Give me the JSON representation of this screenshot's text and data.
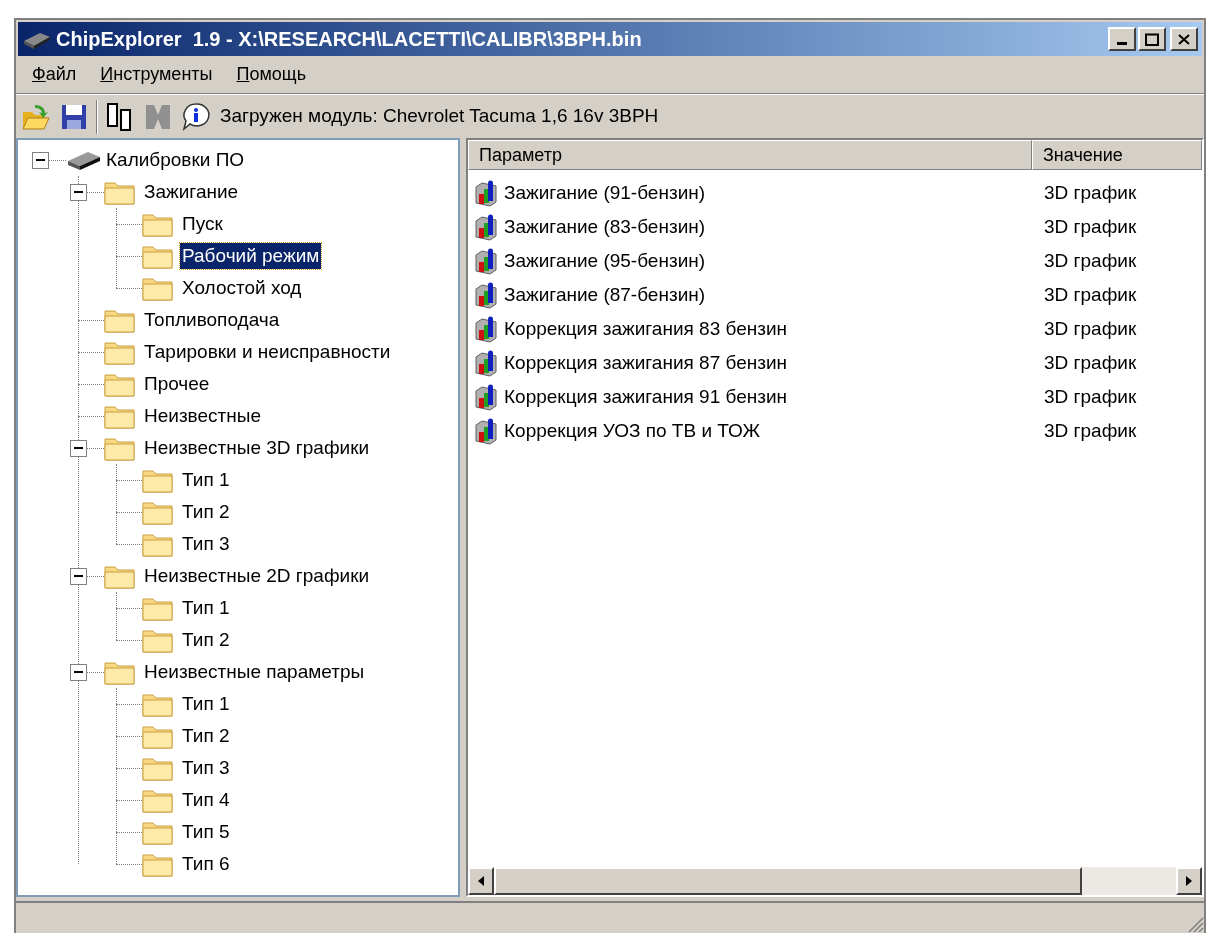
{
  "window": {
    "title": "ChipExplorer  1.9 - X:\\RESEARCH\\LACETTI\\CALIBR\\3BPH.bin"
  },
  "menu": [
    "Файл",
    "Инструменты",
    "Помощь"
  ],
  "toolbar": {
    "buttons": [
      {
        "kind": "open",
        "disabled": false
      },
      {
        "kind": "save",
        "disabled": false
      },
      {
        "kind": "device",
        "disabled": false
      },
      {
        "kind": "chip",
        "disabled": true
      },
      {
        "kind": "info",
        "disabled": false
      }
    ],
    "status_text": "Загружен модуль: Chevrolet Tacuma 1,6 16v 3BPH"
  },
  "tree": [
    {
      "label": "Калибровки ПО",
      "kind": "chip",
      "selected": false,
      "expanded": true,
      "children": [
        {
          "label": "Зажигание",
          "kind": "folder",
          "selected": false,
          "expanded": true,
          "children": [
            {
              "label": "Пуск",
              "kind": "folder",
              "selected": false
            },
            {
              "label": "Рабочий режим",
              "kind": "folder",
              "selected": true
            },
            {
              "label": "Холостой ход",
              "kind": "folder",
              "selected": false
            }
          ]
        },
        {
          "label": "Топливоподача",
          "kind": "folder",
          "selected": false
        },
        {
          "label": "Тарировки и неисправности",
          "kind": "folder",
          "selected": false
        },
        {
          "label": "Прочее",
          "kind": "folder",
          "selected": false
        },
        {
          "label": "Неизвестные",
          "kind": "folder",
          "selected": false
        },
        {
          "label": "Неизвестные 3D графики",
          "kind": "folder",
          "selected": false,
          "expanded": true,
          "children": [
            {
              "label": "Тип 1",
              "kind": "folder",
              "selected": false
            },
            {
              "label": "Тип 2",
              "kind": "folder",
              "selected": false
            },
            {
              "label": "Тип 3",
              "kind": "folder",
              "selected": false
            }
          ]
        },
        {
          "label": "Неизвестные 2D графики",
          "kind": "folder",
          "selected": false,
          "expanded": true,
          "children": [
            {
              "label": "Тип 1",
              "kind": "folder",
              "selected": false
            },
            {
              "label": "Тип 2",
              "kind": "folder",
              "selected": false
            }
          ]
        },
        {
          "label": "Неизвестные параметры",
          "kind": "folder",
          "selected": false,
          "expanded": true,
          "children": [
            {
              "label": "Тип 1",
              "kind": "folder",
              "selected": false
            },
            {
              "label": "Тип 2",
              "kind": "folder",
              "selected": false
            },
            {
              "label": "Тип 3",
              "kind": "folder",
              "selected": false
            },
            {
              "label": "Тип 4",
              "kind": "folder",
              "selected": false
            },
            {
              "label": "Тип 5",
              "kind": "folder",
              "selected": false
            },
            {
              "label": "Тип 6",
              "kind": "folder",
              "selected": false
            }
          ]
        }
      ]
    }
  ],
  "table": {
    "columns": [
      "Параметр",
      "Значение"
    ],
    "rows": [
      {
        "param": "Зажигание (91-бензин)",
        "value": "3D график"
      },
      {
        "param": "Зажигание (83-бензин)",
        "value": "3D график"
      },
      {
        "param": "Зажигание (95-бензин)",
        "value": "3D график"
      },
      {
        "param": "Зажигание (87-бензин)",
        "value": "3D график"
      },
      {
        "param": "Коррекция зажигания 83 бензин",
        "value": "3D график"
      },
      {
        "param": "Коррекция зажигания 87 бензин",
        "value": "3D график"
      },
      {
        "param": "Коррекция зажигания 91 бензин",
        "value": "3D график"
      },
      {
        "param": "Коррекция УОЗ по ТВ и ТОЖ",
        "value": "3D график"
      }
    ]
  }
}
